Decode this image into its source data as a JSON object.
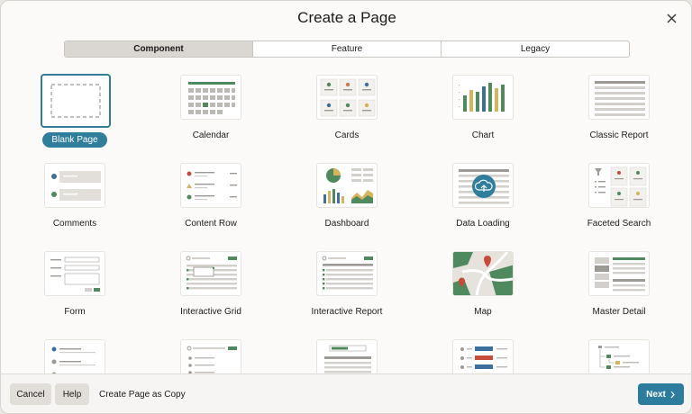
{
  "dialog": {
    "title": "Create a Page"
  },
  "tabs": [
    {
      "label": "Component",
      "active": true
    },
    {
      "label": "Feature",
      "active": false
    },
    {
      "label": "Legacy",
      "active": false
    }
  ],
  "page_types": [
    {
      "label": "Blank Page",
      "icon": "blank-page-icon",
      "selected": true
    },
    {
      "label": "Calendar",
      "icon": "calendar-icon"
    },
    {
      "label": "Cards",
      "icon": "cards-icon"
    },
    {
      "label": "Chart",
      "icon": "chart-icon"
    },
    {
      "label": "Classic Report",
      "icon": "classic-report-icon"
    },
    {
      "label": "Comments",
      "icon": "comments-icon"
    },
    {
      "label": "Content Row",
      "icon": "content-row-icon"
    },
    {
      "label": "Dashboard",
      "icon": "dashboard-icon"
    },
    {
      "label": "Data Loading",
      "icon": "data-loading-icon"
    },
    {
      "label": "Faceted Search",
      "icon": "faceted-search-icon"
    },
    {
      "label": "Form",
      "icon": "form-icon"
    },
    {
      "label": "Interactive Grid",
      "icon": "interactive-grid-icon"
    },
    {
      "label": "Interactive Report",
      "icon": "interactive-report-icon"
    },
    {
      "label": "Map",
      "icon": "map-icon"
    },
    {
      "label": "Master Detail",
      "icon": "master-detail-icon"
    },
    {
      "label": "",
      "icon": "list-view-icon"
    },
    {
      "label": "",
      "icon": "search-page-icon"
    },
    {
      "label": "",
      "icon": "smart-filters-icon"
    },
    {
      "label": "",
      "icon": "status-report-icon"
    },
    {
      "label": "",
      "icon": "tree-icon"
    }
  ],
  "footer": {
    "cancel_label": "Cancel",
    "help_label": "Help",
    "copy_label": "Create Page as Copy",
    "next_label": "Next"
  },
  "colors": {
    "accent": "#2c7c9d",
    "green": "#4f8a5f",
    "orange": "#d27a47",
    "yellow": "#d7b35a",
    "red": "#c84b3a",
    "blue": "#3a6fa0"
  }
}
